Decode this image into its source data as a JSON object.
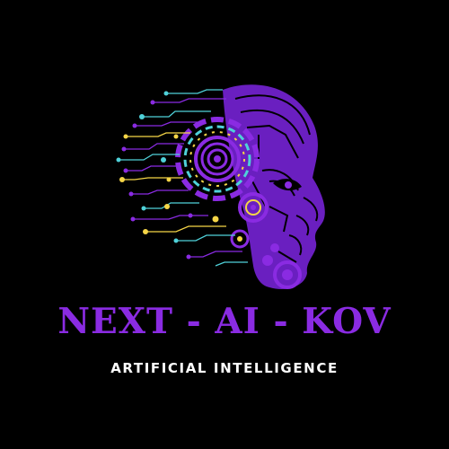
{
  "brand": {
    "title": "NEXT - AI - KOV",
    "subtitle": "ARTIFICIAL INTELLIGENCE"
  },
  "colors": {
    "background": "#000000",
    "accent": "#8a2be2",
    "circuit_cyan": "#4fd1d9",
    "circuit_yellow": "#f5d547",
    "subtitle": "#ffffff"
  },
  "logo": {
    "icon": "robot-head-circuit-icon"
  }
}
